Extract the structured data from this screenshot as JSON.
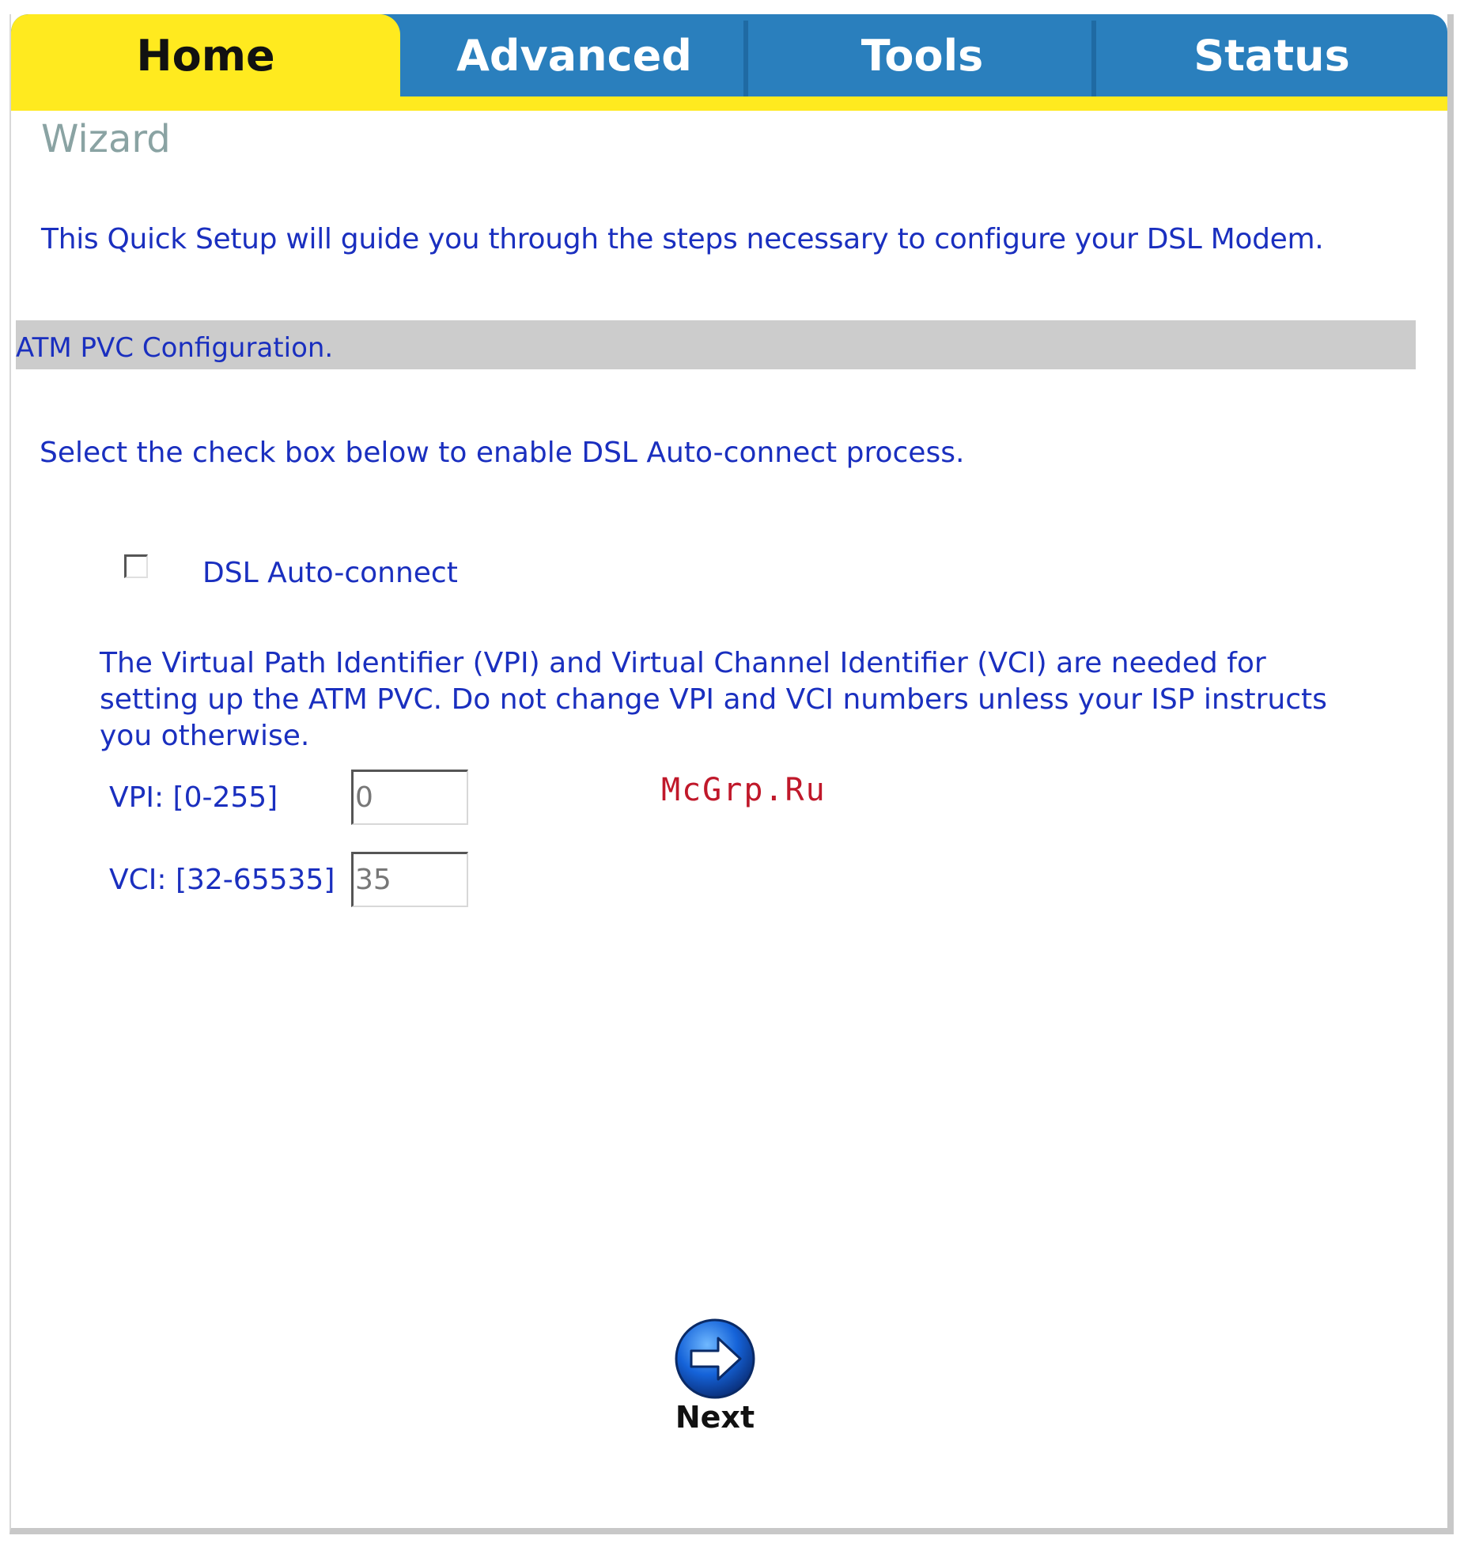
{
  "tabs": [
    {
      "label": "Home",
      "active": true
    },
    {
      "label": "Advanced",
      "active": false
    },
    {
      "label": "Tools",
      "active": false
    },
    {
      "label": "Status",
      "active": false
    }
  ],
  "page_title": "Wizard",
  "intro": "This Quick Setup will guide you through the steps necessary to configure your DSL Modem.",
  "section_title": "ATM PVC Configuration.",
  "select_instruction": "Select the check box below to enable DSL Auto-connect process.",
  "autoconnect": {
    "label": "DSL Auto-connect",
    "checked": false
  },
  "vpi_vci_description": "The Virtual Path Identifier (VPI) and Virtual Channel Identifier (VCI) are needed for setting up the ATM PVC. Do not change VPI and VCI numbers unless your ISP instructs you otherwise.",
  "vpi": {
    "label": "VPI: [0-255]",
    "value": "0"
  },
  "vci": {
    "label": "VCI: [32-65535]",
    "value": "35"
  },
  "watermark": "McGrp.Ru",
  "next_button": {
    "label": "Next",
    "icon": "arrow-right-circle-icon"
  },
  "colors": {
    "tab_blue": "#2a7fbd",
    "tab_active_yellow": "#ffea1f",
    "text_blue": "#1a2fbf",
    "section_bar_gray": "#cccccc"
  }
}
